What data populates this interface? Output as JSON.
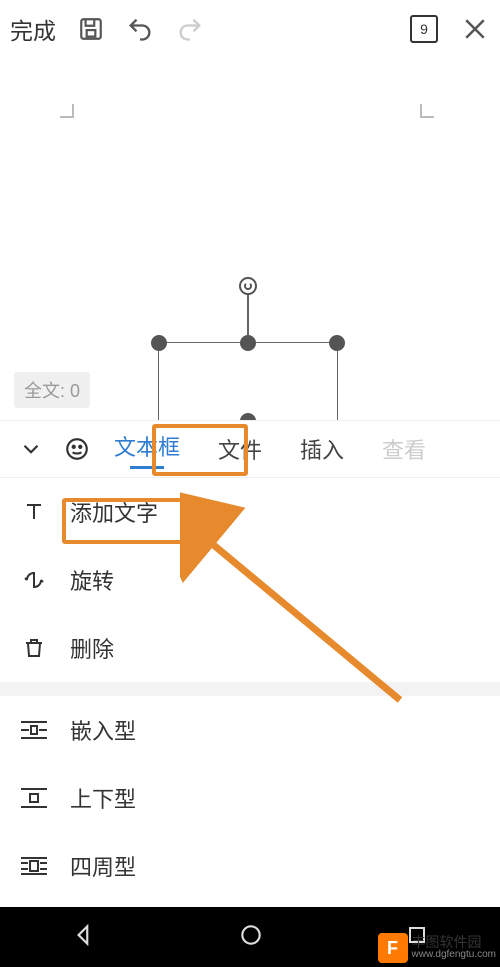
{
  "topbar": {
    "done_label": "完成",
    "page_badge": "9"
  },
  "canvas": {
    "word_count_label": "全文: 0"
  },
  "tabs": {
    "items": [
      {
        "label": "文本框",
        "active": true
      },
      {
        "label": "文件",
        "active": false
      },
      {
        "label": "插入",
        "active": false
      },
      {
        "label": "查看",
        "active": false,
        "faded": true
      }
    ]
  },
  "menu": {
    "group1": [
      {
        "icon": "text-icon",
        "label": "添加文字"
      },
      {
        "icon": "rotate-icon",
        "label": "旋转"
      },
      {
        "icon": "trash-icon",
        "label": "删除"
      }
    ],
    "group2": [
      {
        "icon": "wrap-inline-icon",
        "label": "嵌入型"
      },
      {
        "icon": "wrap-topbot-icon",
        "label": "上下型"
      },
      {
        "icon": "wrap-around-icon",
        "label": "四周型"
      }
    ]
  },
  "watermark": {
    "logo_letter": "F",
    "title": "丰图软件园",
    "url": "www.dgfengtu.com"
  },
  "colors": {
    "accent": "#2f7dd1",
    "highlight": "#e78a2e"
  }
}
